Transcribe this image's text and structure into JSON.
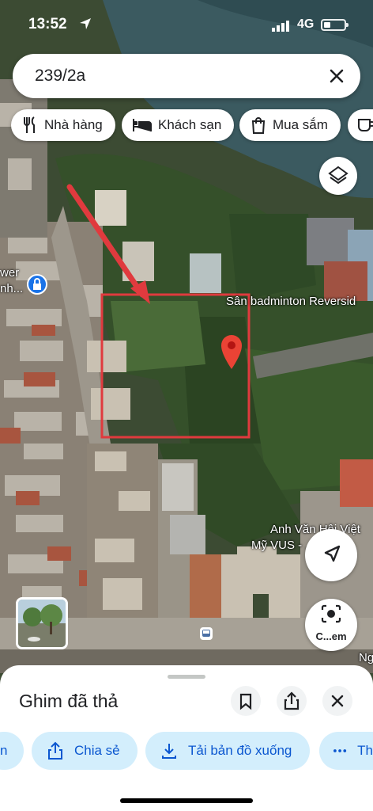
{
  "status": {
    "time": "13:52",
    "network": "4G"
  },
  "search": {
    "query": "239/2a"
  },
  "chips": [
    {
      "label": "Nhà hàng",
      "icon": "fork-knife-icon"
    },
    {
      "label": "Khách sạn",
      "icon": "bed-icon"
    },
    {
      "label": "Mua sắm",
      "icon": "shopping-bag-icon"
    }
  ],
  "map_labels": {
    "badminton": "Sân badminton Reversid",
    "school_line1": "Anh Văn Hội Việt",
    "school_line2": "Mỹ VUS - ...",
    "tower_line1": "wer",
    "tower_line2": "nh...",
    "edge": "Ng"
  },
  "buttons": {
    "lens_label": "C...em"
  },
  "sheet": {
    "title": "Ghim đã thả",
    "actions": [
      {
        "label": "n"
      },
      {
        "label": "Chia sẻ",
        "icon": "share-icon"
      },
      {
        "label": "Tải bản đồ xuống",
        "icon": "download-icon"
      },
      {
        "label": "Th",
        "icon": "more-icon"
      }
    ]
  },
  "colors": {
    "accent": "#0b57d0",
    "pin": "#ea4335",
    "annotation": "#e03a3e",
    "action_bg": "#d3eefc"
  }
}
